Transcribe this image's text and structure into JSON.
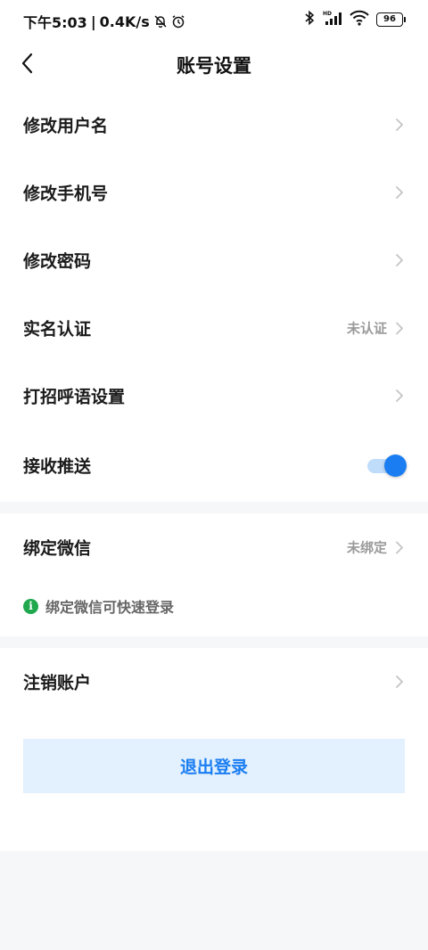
{
  "status_bar": {
    "time": "下午5:03",
    "separator": "|",
    "speed": "0.4K/s",
    "battery": "96",
    "network_label": "HD"
  },
  "header": {
    "title": "账号设置"
  },
  "settings": {
    "items": [
      {
        "label": "修改用户名",
        "value": ""
      },
      {
        "label": "修改手机号",
        "value": ""
      },
      {
        "label": "修改密码",
        "value": ""
      },
      {
        "label": "实名认证",
        "value": "未认证"
      },
      {
        "label": "打招呼语设置",
        "value": ""
      },
      {
        "label": "接收推送",
        "toggle_on": true
      }
    ]
  },
  "wechat": {
    "label": "绑定微信",
    "value": "未绑定",
    "hint_icon": "i",
    "hint": "绑定微信可快速登录"
  },
  "account": {
    "cancel_label": "注销账户"
  },
  "logout": {
    "label": "退出登录"
  },
  "colors": {
    "accent": "#1a7ef2",
    "toggle_track": "#bfdcfb",
    "hint_icon": "#1fa84e",
    "logout_bg": "#e3f0fd"
  }
}
